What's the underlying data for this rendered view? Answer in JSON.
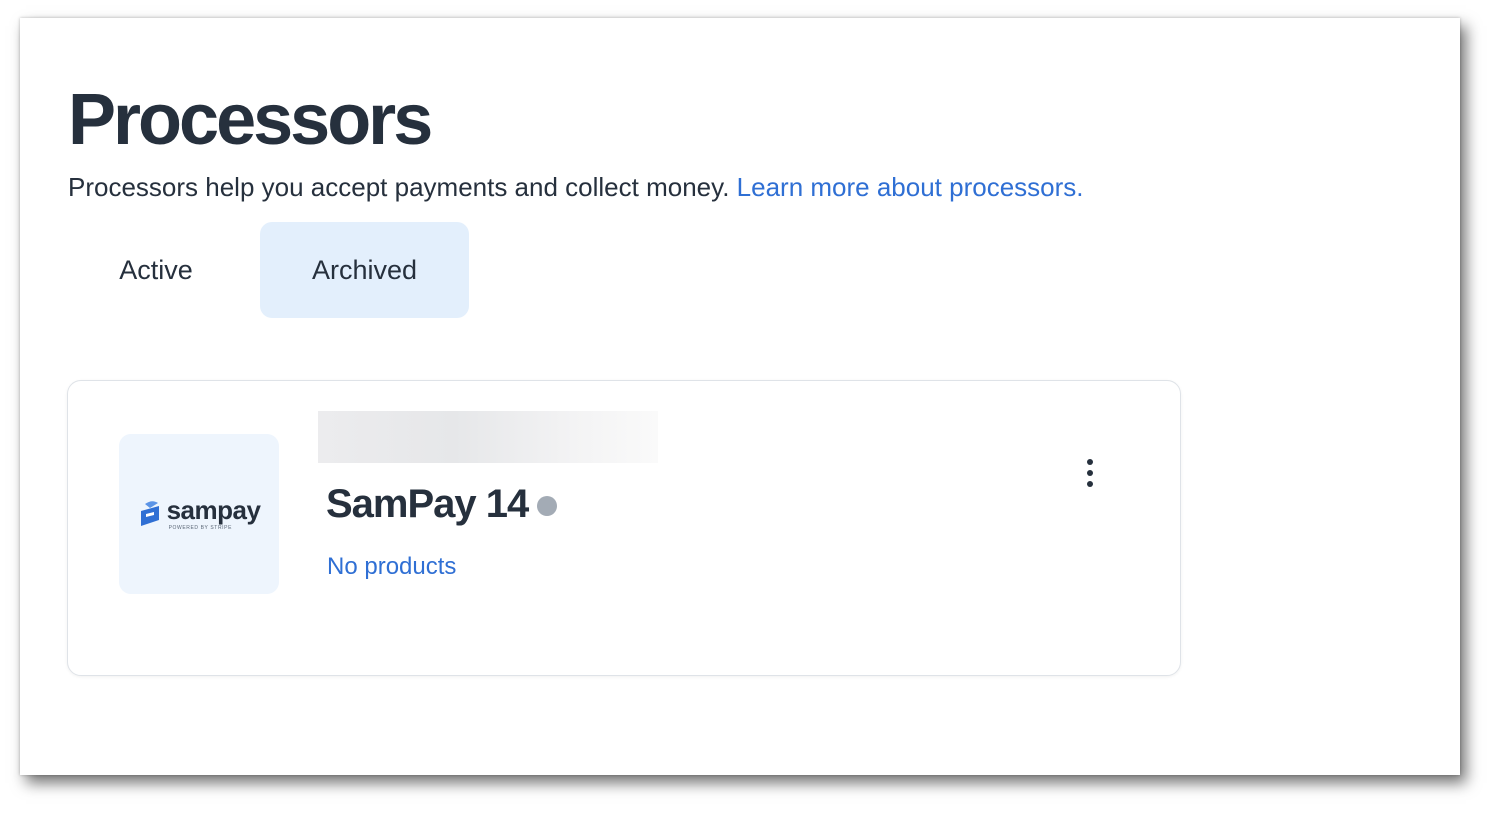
{
  "header": {
    "title": "Processors",
    "subtitle": "Processors help you accept payments and collect money.",
    "learn_more_link": "Learn more about processors."
  },
  "tabs": [
    {
      "label": "Active",
      "selected": false
    },
    {
      "label": "Archived",
      "selected": true
    }
  ],
  "processor": {
    "logo_text": "sampay",
    "logo_subtext": "POWERED BY STRIPE",
    "name": "SamPay 14",
    "status_color": "#a3abb5",
    "products_link": "No products"
  },
  "colors": {
    "text": "#26303d",
    "link": "#2f6fd4",
    "selected_tab_bg": "#e3effc",
    "logo_tile_bg": "#eef5fd"
  }
}
